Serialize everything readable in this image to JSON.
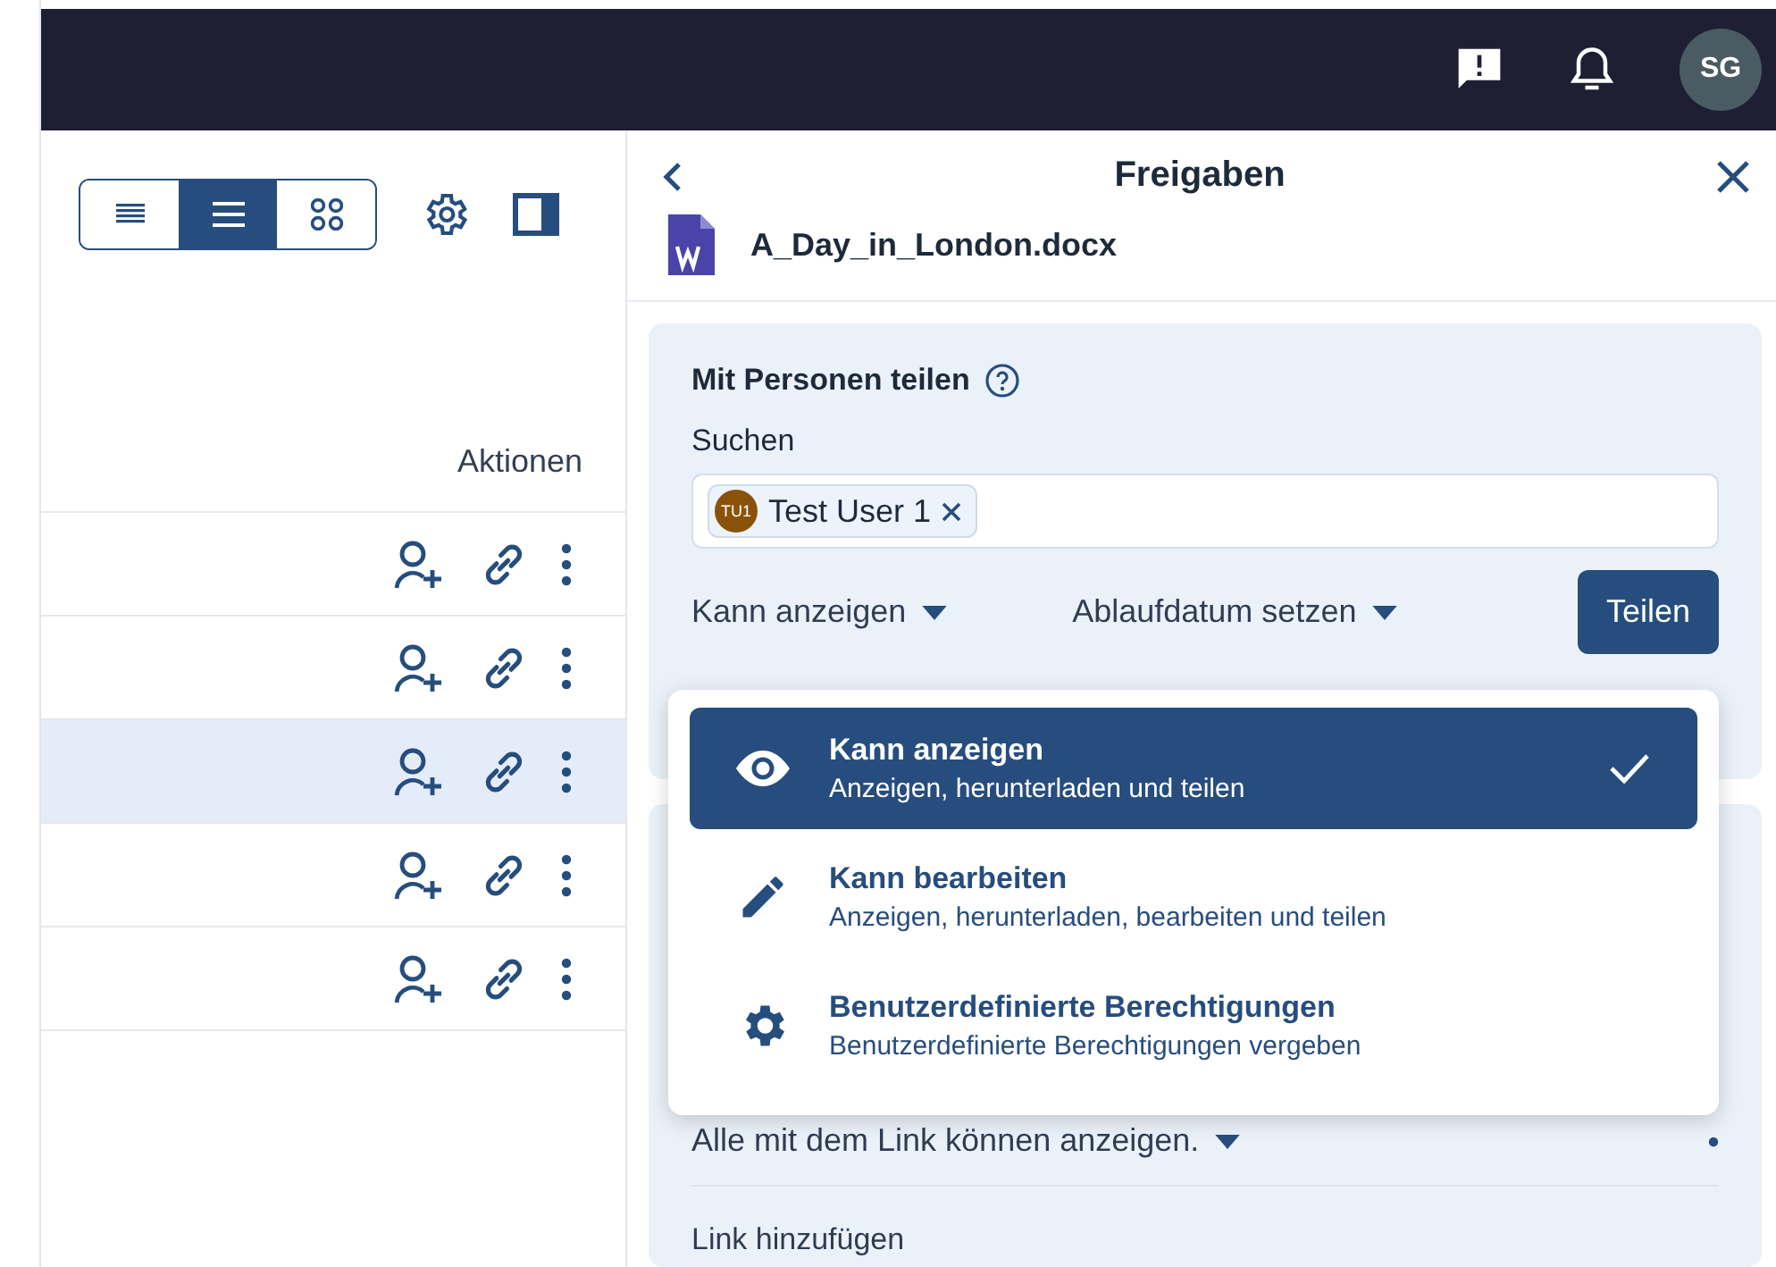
{
  "top_bar": {
    "avatar_initials": "SG"
  },
  "file_list": {
    "view_modes": [
      {
        "selected": false
      },
      {
        "selected": true
      },
      {
        "selected": false
      }
    ],
    "column_header": "Aktionen",
    "rows": [
      {
        "selected": false
      },
      {
        "selected": false
      },
      {
        "selected": true
      },
      {
        "selected": false
      },
      {
        "selected": false
      }
    ]
  },
  "share_panel": {
    "title": "Freigaben",
    "file_name": "A_Day_in_London.docx",
    "people": {
      "heading": "Mit Personen teilen",
      "search_label": "Suchen",
      "chips": [
        {
          "initials": "TU1",
          "name": "Test User 1"
        }
      ],
      "role_dropdown": "Kann anzeigen",
      "expiry_dropdown": "Ablaufdatum setzen",
      "share_button": "Teilen"
    },
    "role_menu": [
      {
        "kind": "view",
        "title": "Kann anzeigen",
        "description": "Anzeigen, herunterladen und teilen",
        "selected": true
      },
      {
        "kind": "edit",
        "title": "Kann bearbeiten",
        "description": "Anzeigen, herunterladen, bearbeiten und teilen",
        "selected": false
      },
      {
        "kind": "custom",
        "title": "Benutzerdefinierte Berechtigungen",
        "description": "Benutzerdefinierte Berechtigungen vergeben",
        "selected": false
      }
    ],
    "links": {
      "permission_dropdown": "Alle mit dem Link können anzeigen.",
      "add_link": "Link hinzufügen"
    }
  }
}
